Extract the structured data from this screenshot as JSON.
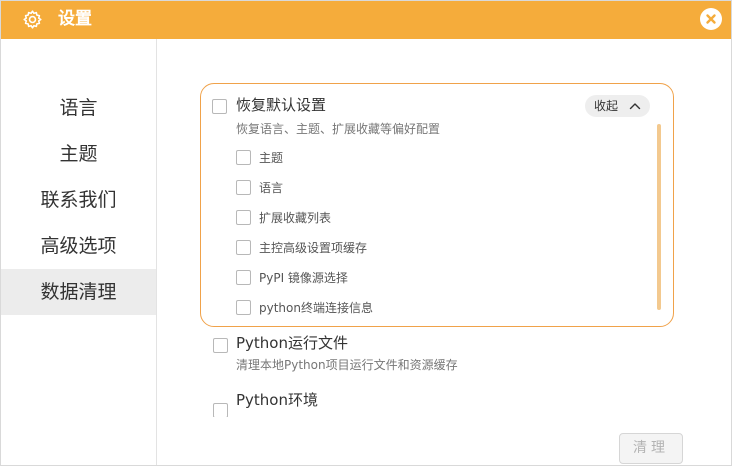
{
  "window": {
    "title": "设置",
    "accent_color": "#f5ac3b",
    "title_icon": "gear-icon",
    "close_icon": "close-icon"
  },
  "sidebar": {
    "items": [
      {
        "label": "语言"
      },
      {
        "label": "主题"
      },
      {
        "label": "联系我们"
      },
      {
        "label": "高级选项"
      },
      {
        "label": "数据清理",
        "active": true
      }
    ]
  },
  "panel": {
    "reset": {
      "title": "恢复默认设置",
      "description": "恢复语言、主题、扩展收藏等偏好配置",
      "collapse_label": "收起",
      "border_color": "#f0a24a",
      "options": [
        {
          "label": "主题",
          "checked": false
        },
        {
          "label": "语言",
          "checked": false
        },
        {
          "label": "扩展收藏列表",
          "checked": false
        },
        {
          "label": "主控高级设置项缓存",
          "checked": false
        },
        {
          "label": "PyPI 镜像源选择",
          "checked": false
        },
        {
          "label": "python终端连接信息",
          "checked": false
        }
      ]
    }
  },
  "sections": [
    {
      "title": "Python运行文件",
      "description": "清理本地Python项目运行文件和资源缓存",
      "checked": false
    },
    {
      "title": "Python环境",
      "checked": false
    }
  ],
  "footer": {
    "clean_label": "清理"
  }
}
